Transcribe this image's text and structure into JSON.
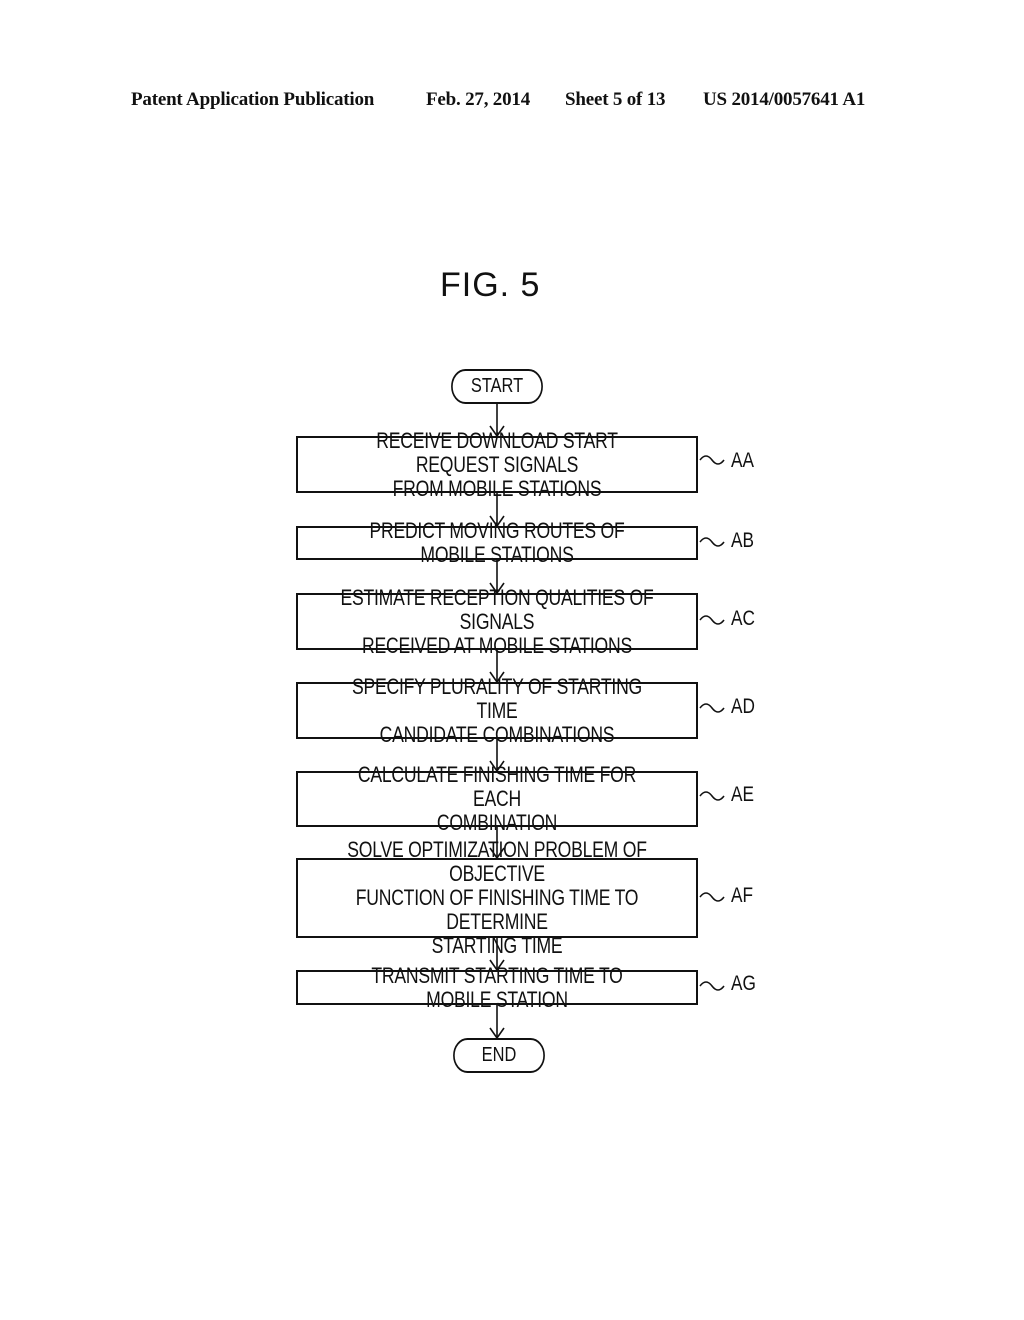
{
  "header": {
    "publication": "Patent Application Publication",
    "date": "Feb. 27, 2014",
    "sheet": "Sheet 5 of 13",
    "number": "US 2014/0057641 A1"
  },
  "figure": {
    "title": "FIG. 5",
    "start_label": "START",
    "end_label": "END",
    "steps": [
      {
        "id": "AA",
        "text": "RECEIVE DOWNLOAD START REQUEST SIGNALS\nFROM MOBILE STATIONS"
      },
      {
        "id": "AB",
        "text": "PREDICT MOVING ROUTES OF MOBILE STATIONS"
      },
      {
        "id": "AC",
        "text": "ESTIMATE RECEPTION QUALITIES OF SIGNALS\nRECEIVED AT MOBILE STATIONS"
      },
      {
        "id": "AD",
        "text": "SPECIFY PLURALITY OF STARTING TIME\nCANDIDATE COMBINATIONS"
      },
      {
        "id": "AE",
        "text": "CALCULATE FINISHING TIME FOR EACH\nCOMBINATION"
      },
      {
        "id": "AF",
        "text": "SOLVE OPTIMIZATION PROBLEM OF OBJECTIVE\nFUNCTION OF FINISHING TIME TO DETERMINE\nSTARTING TIME"
      },
      {
        "id": "AG",
        "text": "TRANSMIT STARTING TIME TO MOBILE STATION"
      }
    ]
  }
}
